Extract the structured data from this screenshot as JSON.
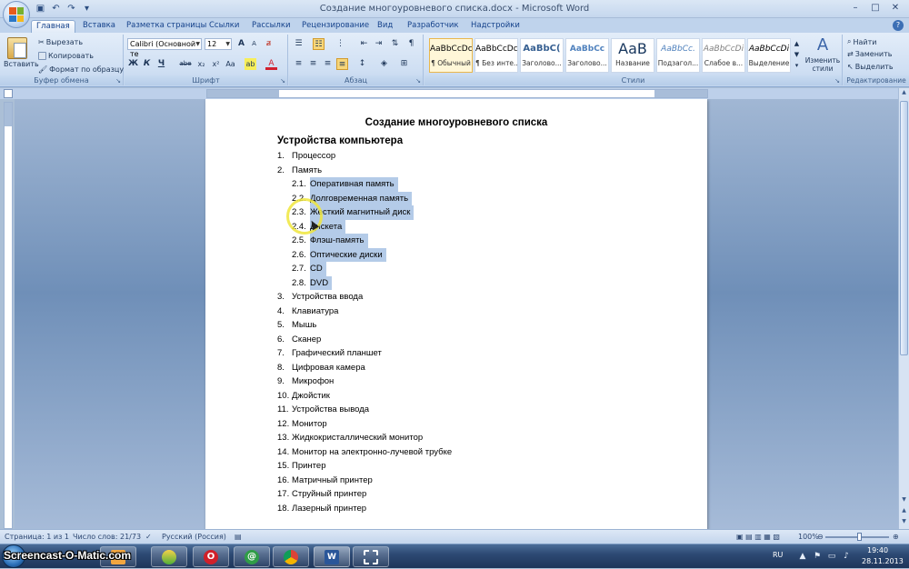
{
  "window": {
    "title": "Создание многоуровневого списка.docx - Microsoft Word",
    "controls": [
      "–",
      "□",
      "✕"
    ]
  },
  "quick_access": [
    "save-icon",
    "undo-icon",
    "redo-icon",
    "customize-icon"
  ],
  "tabs": [
    "Главная",
    "Вставка",
    "Разметка страницы",
    "Ссылки",
    "Рассылки",
    "Рецензирование",
    "Вид",
    "Разработчик",
    "Надстройки"
  ],
  "ribbon": {
    "clipboard": {
      "paste": "Вставить",
      "cut": "Вырезать",
      "copy": "Копировать",
      "format_painter": "Формат по образцу",
      "label": "Буфер обмена"
    },
    "font": {
      "name": "Calibri (Основной те",
      "size": "12",
      "bold": "Ж",
      "italic": "К",
      "underline": "Ч",
      "strike": "abe",
      "subscript": "x₂",
      "superscript": "x²",
      "change_case": "Aa",
      "grow": "A",
      "shrink": "A",
      "clear": "ⱥ",
      "highlight": "ab",
      "color": "A",
      "label": "Шрифт"
    },
    "paragraph": {
      "label": "Абзац"
    },
    "styles": {
      "label": "Стили",
      "items": [
        {
          "sample": "AaBbCcDc",
          "name": "¶ Обычный"
        },
        {
          "sample": "AaBbCcDc",
          "name": "¶ Без инте..."
        },
        {
          "sample": "AaBbC(",
          "name": "Заголово..."
        },
        {
          "sample": "AaBbCc",
          "name": "Заголово..."
        },
        {
          "sample": "AaB",
          "name": "Название"
        },
        {
          "sample": "AaBbCc.",
          "name": "Подзагол..."
        },
        {
          "sample": "AaBbCcDi",
          "name": "Слабое в..."
        },
        {
          "sample": "AaBbCcDi",
          "name": "Выделение"
        }
      ],
      "change_styles": "Изменить стили"
    },
    "editing": {
      "find": "Найти",
      "replace": "Заменить",
      "select": "Выделить",
      "label": "Редактирование"
    }
  },
  "document": {
    "heading": "Создание многоуровневого списка",
    "subheading": "Устройства компьютера",
    "items": [
      {
        "num": "1.",
        "text": "Процессор",
        "level": 1
      },
      {
        "num": "2.",
        "text": "Память",
        "level": 1
      },
      {
        "num": "2.1.",
        "text": "Оперативная память",
        "level": 2
      },
      {
        "num": "2.2.",
        "text": "Долговременная память",
        "level": 2
      },
      {
        "num": "2.3.",
        "text": "Жесткий магнитный диск",
        "level": 2
      },
      {
        "num": "2.4.",
        "text": "Дискета",
        "level": 2
      },
      {
        "num": "2.5.",
        "text": "Флэш-память",
        "level": 2
      },
      {
        "num": "2.6.",
        "text": "Оптические диски",
        "level": 2
      },
      {
        "num": "2.7.",
        "text": "CD",
        "level": 2
      },
      {
        "num": "2.8.",
        "text": "DVD",
        "level": 2
      },
      {
        "num": "3.",
        "text": "Устройства ввода",
        "level": 1
      },
      {
        "num": "4.",
        "text": "Клавиатура",
        "level": 1
      },
      {
        "num": "5.",
        "text": "Мышь",
        "level": 1
      },
      {
        "num": "6.",
        "text": "Сканер",
        "level": 1
      },
      {
        "num": "7.",
        "text": "Графический планшет",
        "level": 1
      },
      {
        "num": "8.",
        "text": "Цифровая камера",
        "level": 1
      },
      {
        "num": "9.",
        "text": "Микрофон",
        "level": 1
      },
      {
        "num": "10.",
        "text": "Джойстик",
        "level": 1
      },
      {
        "num": "11.",
        "text": "Устройства вывода",
        "level": 1
      },
      {
        "num": "12.",
        "text": "Монитор",
        "level": 1
      },
      {
        "num": "13.",
        "text": "Жидкокристаллический монитор",
        "level": 1
      },
      {
        "num": "14.",
        "text": "Монитор на электронно-лучевой трубке",
        "level": 1
      },
      {
        "num": "15.",
        "text": "Принтер",
        "level": 1
      },
      {
        "num": "16.",
        "text": "Матричный принтер",
        "level": 1
      },
      {
        "num": "17.",
        "text": "Струйный принтер",
        "level": 1
      },
      {
        "num": "18.",
        "text": "Лазерный принтер",
        "level": 1
      }
    ]
  },
  "statusbar": {
    "page": "Страница: 1 из 1",
    "words": "Число слов: 21/73",
    "language": "Русский (Россия)",
    "zoom": "100%"
  },
  "taskbar": {
    "watermark": "Screencast-O-Matic.com",
    "apps": [
      "explorer-icon",
      "media-icon",
      "opera-icon",
      "mail-icon",
      "chrome-icon",
      "word-icon",
      "screen-capture-icon"
    ],
    "lang": "RU",
    "time": "19:40",
    "date": "28.11.2013"
  },
  "colors": {
    "selection": "#b4cbe8",
    "ribbon_bg": "#dbe7f5",
    "doc_bg": "#6f8fb8"
  }
}
